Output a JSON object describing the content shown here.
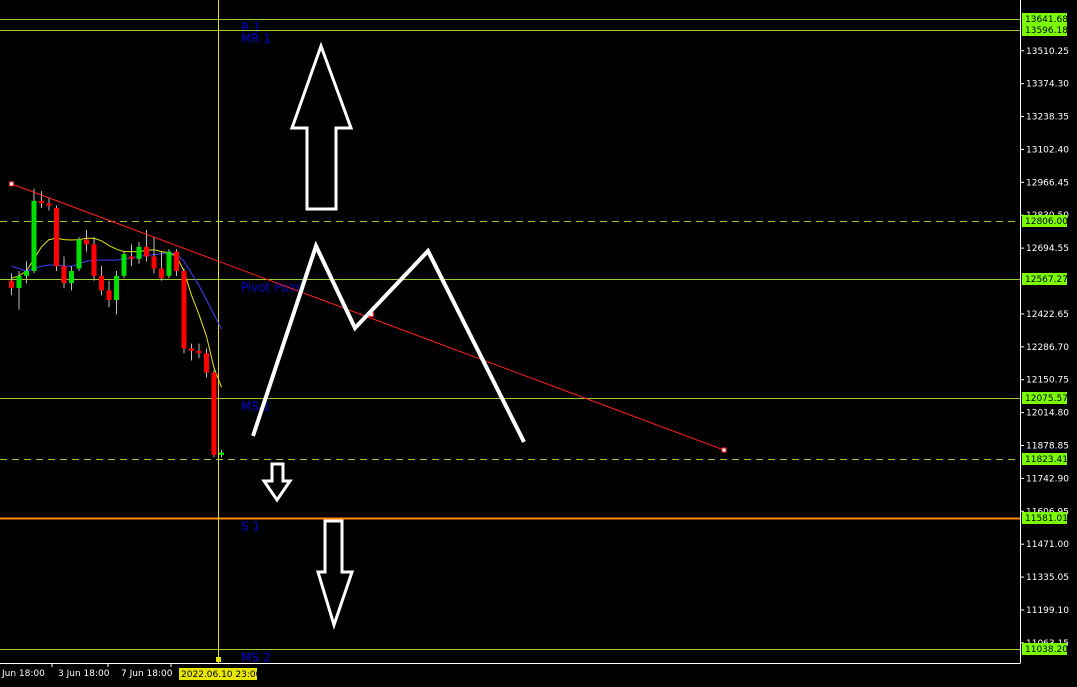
{
  "colors": {
    "background": "#000000",
    "frame": "#ffffff",
    "level_line": "#9acd32",
    "support_line": "#ff8c00",
    "level_label": "#0000cd",
    "badge_bg": "#7cfc00",
    "badge_text": "#000000",
    "cursor_line": "#e6e600",
    "trend_line": "#ff2020",
    "bull_candle": "#00e000",
    "bear_candle": "#ff0000",
    "candle_wick": "#c0c0c0",
    "ma_fast": "#e6e600",
    "ma_slow": "#4040ff",
    "drawing": "#ffffff"
  },
  "chart_data": {
    "type": "candlestick",
    "symbol": "",
    "y_axis": {
      "min": 10980,
      "max": 13720,
      "ticks": [
        13510.25,
        13374.3,
        13238.35,
        13102.4,
        12966.45,
        12830.5,
        12694.55,
        12422.65,
        12286.7,
        12150.75,
        12014.8,
        11878.85,
        11742.9,
        11606.95,
        11471.0,
        11335.05,
        11199.1,
        11063.15
      ],
      "tick_labels": [
        "13510.25",
        "13374.30",
        "13238.35",
        "13102.40",
        "12966.45",
        "12830.50",
        "12694.55",
        "12422.65",
        "12286.70",
        "12150.75",
        "12014.80",
        "11878.85",
        "11742.90",
        "11606.95",
        "11471.00",
        "11335.05",
        "11199.10",
        "11063.15"
      ]
    },
    "x_axis": {
      "labels": [
        "Jun 18:00",
        "3 Jun 18:00",
        "7 Jun 18:00"
      ],
      "cursor_label": "2022.06.10 23:00"
    },
    "levels": [
      {
        "value": 13641.68,
        "label": "R 1",
        "badge": "13641.68",
        "style": "solid"
      },
      {
        "value": 13596.18,
        "label": "MR 1",
        "badge": "13596.18",
        "style": "solid"
      },
      {
        "value": 12806.0,
        "label": "",
        "badge": "12806.00",
        "style": "dashed"
      },
      {
        "value": 12567.27,
        "label": "Pivot Point",
        "badge": "12567.27",
        "style": "solid"
      },
      {
        "value": 12075.57,
        "label": "MS 1",
        "badge": "12075.57",
        "style": "solid"
      },
      {
        "value": 11823.41,
        "label": "",
        "badge": "11823.41",
        "style": "dashed"
      },
      {
        "value": 11581.01,
        "label": "S 1",
        "badge": "11581.01",
        "style": "support"
      },
      {
        "value": 11038.2,
        "label": "MS 2",
        "badge": "11038.20",
        "style": "solid"
      }
    ],
    "candles": [
      {
        "o": 12560,
        "h": 12590,
        "l": 12500,
        "c": 12530
      },
      {
        "o": 12530,
        "h": 12600,
        "l": 12440,
        "c": 12580
      },
      {
        "o": 12580,
        "h": 12640,
        "l": 12550,
        "c": 12600
      },
      {
        "o": 12600,
        "h": 12940,
        "l": 12590,
        "c": 12890
      },
      {
        "o": 12890,
        "h": 12930,
        "l": 12860,
        "c": 12880
      },
      {
        "o": 12880,
        "h": 12900,
        "l": 12850,
        "c": 12870
      },
      {
        "o": 12860,
        "h": 12870,
        "l": 12600,
        "c": 12620
      },
      {
        "o": 12620,
        "h": 12660,
        "l": 12530,
        "c": 12550
      },
      {
        "o": 12550,
        "h": 12620,
        "l": 12520,
        "c": 12600
      },
      {
        "o": 12610,
        "h": 12740,
        "l": 12600,
        "c": 12730
      },
      {
        "o": 12730,
        "h": 12770,
        "l": 12680,
        "c": 12710
      },
      {
        "o": 12710,
        "h": 12740,
        "l": 12560,
        "c": 12580
      },
      {
        "o": 12580,
        "h": 12620,
        "l": 12500,
        "c": 12520
      },
      {
        "o": 12520,
        "h": 12560,
        "l": 12450,
        "c": 12480
      },
      {
        "o": 12480,
        "h": 12600,
        "l": 12420,
        "c": 12580
      },
      {
        "o": 12580,
        "h": 12680,
        "l": 12570,
        "c": 12670
      },
      {
        "o": 12660,
        "h": 12710,
        "l": 12620,
        "c": 12650
      },
      {
        "o": 12650,
        "h": 12720,
        "l": 12630,
        "c": 12700
      },
      {
        "o": 12700,
        "h": 12770,
        "l": 12640,
        "c": 12660
      },
      {
        "o": 12660,
        "h": 12740,
        "l": 12590,
        "c": 12610
      },
      {
        "o": 12610,
        "h": 12680,
        "l": 12560,
        "c": 12570
      },
      {
        "o": 12580,
        "h": 12690,
        "l": 12570,
        "c": 12680
      },
      {
        "o": 12680,
        "h": 12690,
        "l": 12580,
        "c": 12600
      },
      {
        "o": 12600,
        "h": 12610,
        "l": 12260,
        "c": 12280
      },
      {
        "o": 12280,
        "h": 12300,
        "l": 12230,
        "c": 12270
      },
      {
        "o": 12270,
        "h": 12300,
        "l": 12240,
        "c": 12260
      },
      {
        "o": 12260,
        "h": 12280,
        "l": 12160,
        "c": 12180
      },
      {
        "o": 12180,
        "h": 12190,
        "l": 11830,
        "c": 11840
      },
      {
        "o": 11840,
        "h": 11860,
        "l": 11830,
        "c": 11850
      }
    ],
    "ma_fast": [
      12570,
      12580,
      12600,
      12650,
      12700,
      12730,
      12735,
      12730,
      12728,
      12730,
      12735,
      12735,
      12725,
      12705,
      12690,
      12680,
      12680,
      12680,
      12685,
      12688,
      12680,
      12675,
      12660,
      12600,
      12500,
      12420,
      12330,
      12200,
      12120
    ],
    "ma_slow": [
      12620,
      12610,
      12600,
      12610,
      12620,
      12625,
      12625,
      12620,
      12620,
      12630,
      12640,
      12645,
      12645,
      12645,
      12645,
      12650,
      12655,
      12660,
      12665,
      12668,
      12672,
      12675,
      12670,
      12640,
      12590,
      12540,
      12480,
      12420,
      12360
    ],
    "trend_line": {
      "start": {
        "candle": 0,
        "value": 12960
      },
      "end": {
        "candle": 95,
        "value": 11860
      },
      "mid_marker": {
        "candle": 48,
        "value": 12420
      }
    },
    "annotations": [
      {
        "type": "arrow-up",
        "label": ""
      },
      {
        "type": "m-pattern",
        "label": ""
      },
      {
        "type": "arrow-down-small",
        "label": ""
      },
      {
        "type": "arrow-down",
        "label": ""
      }
    ]
  }
}
